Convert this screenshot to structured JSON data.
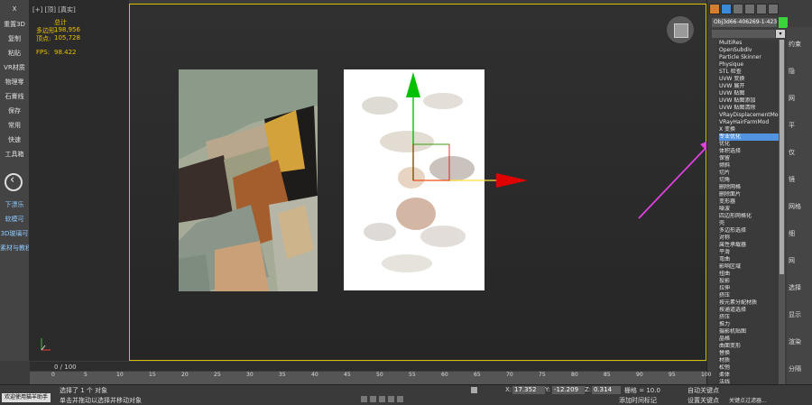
{
  "left_toolbar": {
    "items": [
      "X",
      "重置3D",
      "复制",
      "粘贴",
      "VR材质",
      "物理零",
      "石膏线",
      "保存",
      "常用",
      "快速",
      "工具箱"
    ],
    "blue_items": [
      "下漂乐",
      "软模可",
      "3D玻璃可",
      "素材与教程"
    ]
  },
  "viewport": {
    "label": "[+] [顶] [真实]",
    "stats": {
      "header": "总计",
      "polys_label": "多边形:",
      "polys_value": "198,956",
      "verts_label": "顶点:",
      "verts_value": "105,728",
      "fps_label": "FPS:",
      "fps_value": "98.422"
    }
  },
  "command_panel": {
    "object_name": "Obj3d66-406269-1-423",
    "modifier_list": [
      "MultiRes",
      "OpenSubdiv",
      "Particle Skinner",
      "Physique",
      "STL 检查",
      "UVW 变换",
      "UVW 展开",
      "UVW 贴图",
      "UVW 贴图添加",
      "UVW 贴图清除",
      "VRayDisplacementMod",
      "VRayHairFarmMod",
      "X 变换",
      "专业优化",
      "优化",
      "体积选择",
      "保留",
      "倾斜",
      "切片",
      "切角",
      "删除网格",
      "删除面片",
      "变形器",
      "噪波",
      "四边形网格化",
      "壳",
      "多边形选择",
      "对称",
      "属性承载器",
      "平滑",
      "弯曲",
      "影响区域",
      "扭曲",
      "投影",
      "拉伸",
      "挤压",
      "按元素分配材质",
      "按通道选择",
      "挤压",
      "推力",
      "摄影机贴图",
      "晶格",
      "曲面变形",
      "替换",
      "材质",
      "松弛",
      "柔体",
      "法线"
    ],
    "selected_index": 13,
    "side_labels": [
      "约束",
      "隐",
      "网",
      "平",
      "仅",
      "镜",
      "网格",
      "细",
      "网",
      "选择",
      "显示",
      "渲染",
      "分隔"
    ]
  },
  "timeline": {
    "frame_indicator": "0 / 100",
    "ticks": [
      "0",
      "5",
      "10",
      "15",
      "20",
      "25",
      "30",
      "35",
      "40",
      "45",
      "50",
      "55",
      "60",
      "65",
      "70",
      "75",
      "80",
      "85",
      "90",
      "95",
      "100"
    ]
  },
  "status_bar": {
    "welcome": "欢迎使用猫羊助手",
    "line1": "选择了 1 个 对象",
    "line2": "单击并拖动以选择并移动对象",
    "x_label": "X:",
    "x_value": "17.352",
    "y_label": "Y:",
    "y_value": "-12.209",
    "z_label": "Z:",
    "z_value": "0.314",
    "grid": "栅格 = 10.0",
    "add_time": "添加时间标记",
    "auto_key": "自动关键点",
    "set_key": "设置关键点",
    "key_filter": "关键点过滤器..."
  },
  "colors": {
    "viewport_border": "#d6c200",
    "stats_text": "#e8c200",
    "selection": "#5294e2",
    "gizmo_x": "#e00000",
    "gizmo_y": "#00c000",
    "gizmo_z": "#ffe040",
    "annotation_arrow": "#e040e0"
  }
}
